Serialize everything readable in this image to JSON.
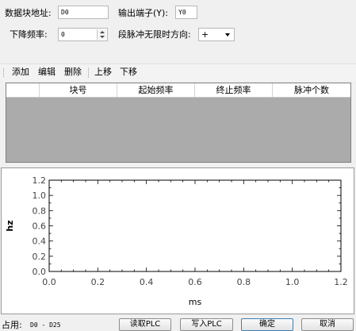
{
  "form": {
    "block_addr_label": "数据块地址:",
    "block_addr_value": "D0",
    "output_port_label": "输出端子(Y):",
    "output_port_value": "Y0",
    "decel_freq_label": "下降频率:",
    "decel_freq_value": "0",
    "direction_label": "段脉冲无限时方向:",
    "direction_value": "+"
  },
  "toolbar": {
    "add": "添加",
    "edit": "编辑",
    "delete": "删除",
    "move_up": "上移",
    "move_down": "下移"
  },
  "table": {
    "columns": [
      "块号",
      "起始频率",
      "终止频率",
      "脉冲个数"
    ],
    "rows": []
  },
  "chart_data": {
    "type": "line",
    "xlabel": "ms",
    "ylabel": "hz",
    "xlim": [
      0.0,
      1.2
    ],
    "ylim": [
      0.0,
      1.2
    ],
    "x_ticks": [
      "0.0",
      "0.2",
      "0.4",
      "0.6",
      "0.8",
      "1.0",
      "1.2"
    ],
    "y_ticks": [
      "0.0",
      "0.2",
      "0.4",
      "0.6",
      "0.8",
      "1.0",
      "1.2"
    ],
    "series": [],
    "grid": false
  },
  "status": {
    "usage_label": "占用:",
    "usage_value": "D0 - D25"
  },
  "buttons": {
    "read_plc": "读取PLC",
    "write_plc": "写入PLC",
    "ok": "确定",
    "cancel": "取消"
  }
}
